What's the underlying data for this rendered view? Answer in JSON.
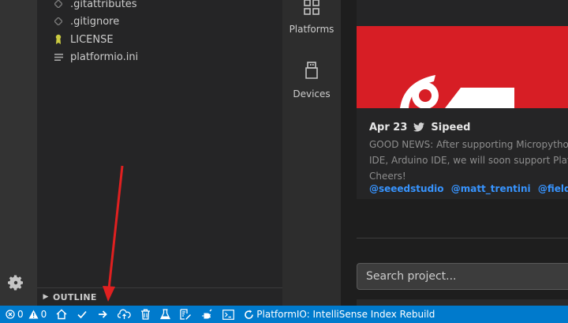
{
  "explorer": {
    "files": [
      {
        "name": ".gitattributes",
        "icon": "diamond-icon"
      },
      {
        "name": ".gitignore",
        "icon": "diamond-icon"
      },
      {
        "name": "LICENSE",
        "icon": "license-icon"
      },
      {
        "name": "platformio.ini",
        "icon": "lines-icon"
      }
    ],
    "outline_label": "OUTLINE"
  },
  "pio_sidebar": {
    "platforms_label": "Platforms",
    "devices_label": "Devices"
  },
  "news": {
    "date": "Apr 23",
    "author": "Sipeed",
    "body_lines": [
      "GOOD NEWS: After supporting Micropytho",
      "IDE, Arduino IDE, we will soon support Platf",
      "Cheers!"
    ],
    "mentions": [
      "@seeedstudio",
      "@matt_trentini",
      "@field_ha"
    ],
    "image_color": "#d71e25"
  },
  "search": {
    "placeholder": "Search project..."
  },
  "status_bar": {
    "errors_count": "0",
    "warnings_count": "0",
    "task_label": "PlatformIO: IntelliSense Index Rebuild",
    "background_color": "#007acc"
  },
  "colors": {
    "annotation_arrow": "#e02020"
  }
}
